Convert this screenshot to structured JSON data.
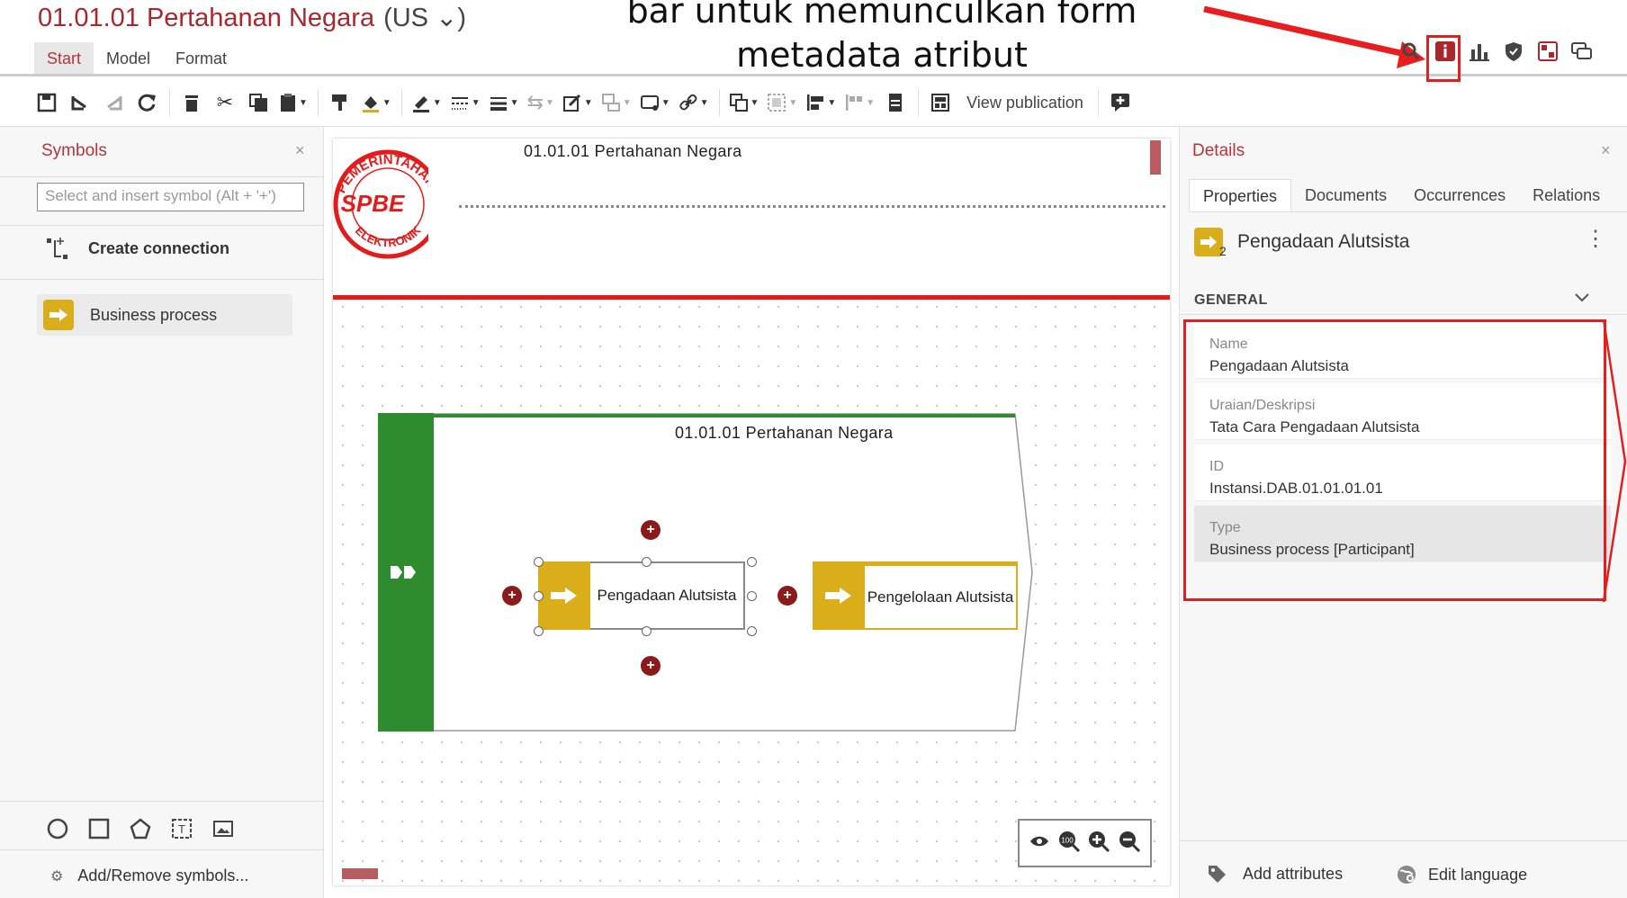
{
  "header": {
    "title": "01.01.01 Pertahanan Negara",
    "language": "(US ⌄)",
    "annotation_text_line1": "bar untuk memunculkan form",
    "annotation_text_line2": "metadata atribut"
  },
  "tabs": [
    {
      "label": "Start",
      "active": true
    },
    {
      "label": "Model",
      "active": false
    },
    {
      "label": "Format",
      "active": false
    }
  ],
  "toolbar": {
    "view_publication_label": "View publication"
  },
  "symbols_panel": {
    "title": "Symbols",
    "close": "×",
    "search_placeholder": "Select and insert symbol (Alt + '+')",
    "create_connection_label": "Create connection",
    "items": [
      {
        "label": "Business process"
      }
    ],
    "add_remove_label": "Add/Remove symbols..."
  },
  "canvas": {
    "header_title": "01.01.01 Pertahanan Negara",
    "logo_text_top": "PEMERINTAHAN",
    "logo_text_center": "SPBE",
    "logo_text_bottom": "ELEKTRONIK",
    "pool_title": "01.01.01 Pertahanan Negara",
    "processes": [
      {
        "label": "Pengadaan Alutsista"
      },
      {
        "label": "Pengelolaan Alutsista"
      }
    ],
    "zoom_100_label": "100"
  },
  "details_panel": {
    "title": "Details",
    "close": "×",
    "tabs": [
      {
        "label": "Properties",
        "active": true
      },
      {
        "label": "Documents",
        "active": false
      },
      {
        "label": "Occurrences",
        "active": false
      },
      {
        "label": "Relations",
        "active": false
      }
    ],
    "object_name": "Pengadaan Alutsista",
    "object_badge": "2",
    "section_label": "GENERAL",
    "properties": [
      {
        "label": "Name",
        "value": "Pengadaan Alutsista",
        "selected": false
      },
      {
        "label": "Uraian/Deskripsi",
        "value": "Tata Cara Pengadaan Alutsista",
        "selected": false
      },
      {
        "label": "ID",
        "value": "Instansi.DAB.01.01.01.01",
        "selected": false
      },
      {
        "label": "Type",
        "value": "Business process [Participant]",
        "selected": true
      }
    ],
    "add_attributes_label": "Add attributes",
    "edit_language_label": "Edit language"
  },
  "colors": {
    "brand_red": "#b5343a",
    "process_yellow": "#d9ae1a",
    "pool_green": "#2e8b2e",
    "annotation_red": "#e02020"
  }
}
